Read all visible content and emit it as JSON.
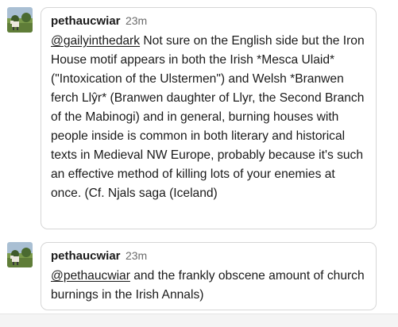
{
  "replies": [
    {
      "username": "pethaucwiar",
      "time": "23m",
      "mention": "@gailyinthedark",
      "text": " Not sure on the English side but the Iron House motif appears in both the Irish *Mesca Ulaid* (\"Intoxication of the Ulstermen\") and Welsh *Branwen ferch Llŷr* (Branwen daughter of Llyr, the Second Branch of the Mabinogi) and in general, burning houses with people inside is common in both literary and historical texts in Medieval NW Europe, probably because it's such an effective method of killing lots of your enemies at once. (Cf. Njals saga (Iceland)"
    },
    {
      "username": "pethaucwiar",
      "time": "23m",
      "mention": "@pethaucwiar",
      "text": " and the frankly obscene amount of church burnings in the Irish Annals)"
    }
  ]
}
